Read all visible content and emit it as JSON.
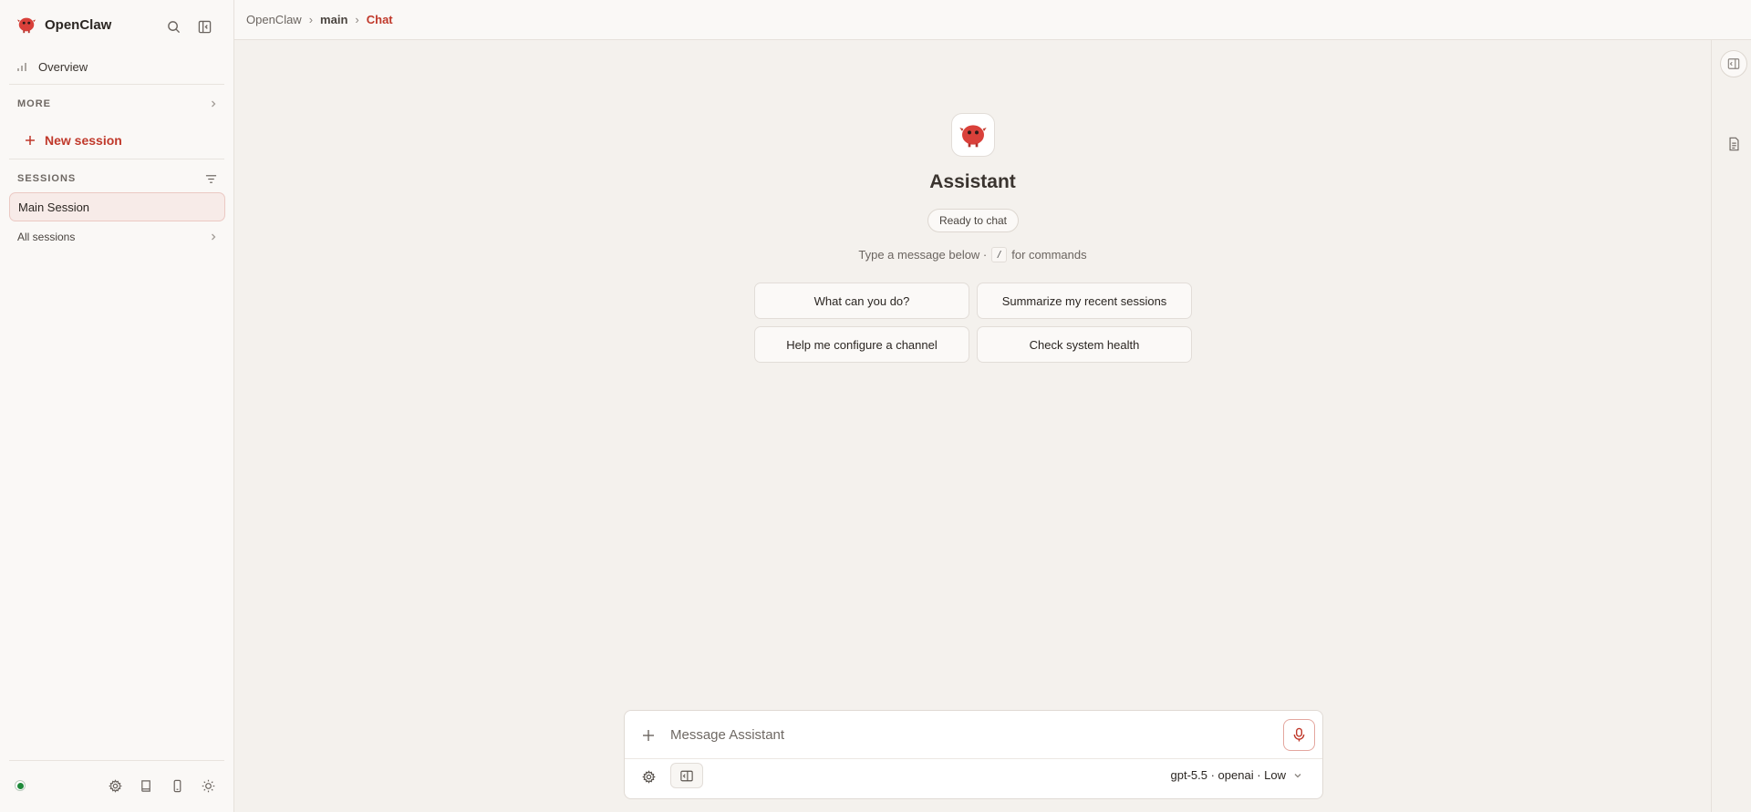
{
  "app": {
    "name": "OpenClaw",
    "brand_color": "#c0392b"
  },
  "sidebar": {
    "overview_label": "Overview",
    "more_label": "MORE",
    "new_session_label": "New session",
    "sessions_label": "SESSIONS",
    "sessions": [
      {
        "label": "Main Session",
        "active": true
      }
    ],
    "all_sessions_label": "All sessions",
    "status": "online"
  },
  "breadcrumb": [
    "OpenClaw",
    "main",
    "Chat"
  ],
  "welcome": {
    "title": "Assistant",
    "status_badge": "Ready to chat",
    "hint_before": "Type a message below ·",
    "hint_key": "/",
    "hint_after": "for commands",
    "suggestions": [
      "What can you do?",
      "Summarize my recent sessions",
      "Help me configure a channel",
      "Check system health"
    ]
  },
  "composer": {
    "placeholder": "Message Assistant",
    "model_label": "gpt-5.5 · openai · Low"
  },
  "icons": {
    "logo": "openclaw-mascot-icon",
    "search": "search-icon",
    "collapse_sidebar": "sidebar-collapse-icon",
    "overview": "bar-chart-icon",
    "filter": "filter-icon",
    "settings": "gear-icon",
    "docs": "book-icon",
    "mobile": "phone-icon",
    "theme": "sun-icon",
    "attach": "plus-icon",
    "mic": "microphone-icon"
  }
}
